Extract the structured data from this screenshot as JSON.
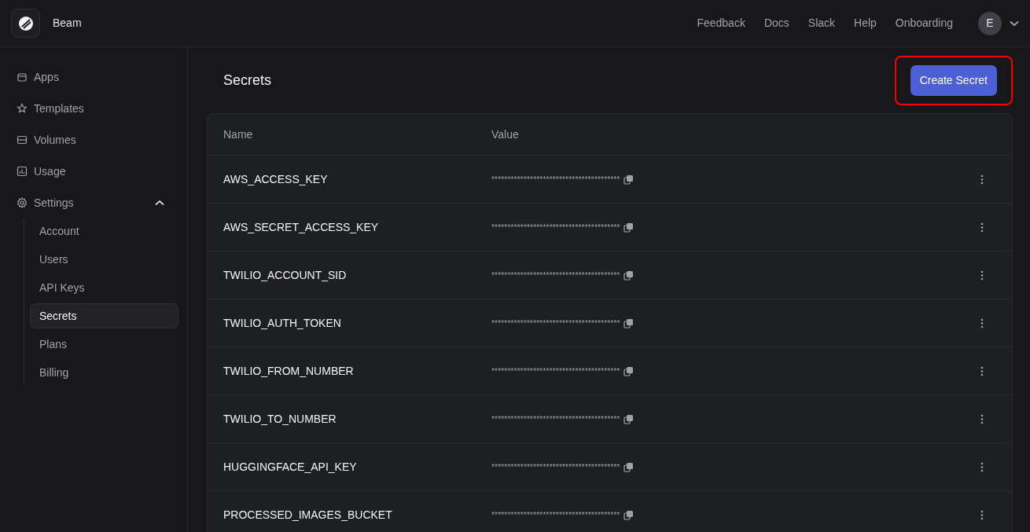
{
  "brand": {
    "name": "Beam"
  },
  "topnav": {
    "links": [
      "Feedback",
      "Docs",
      "Slack",
      "Help",
      "Onboarding"
    ],
    "avatar": "E"
  },
  "sidebar": {
    "items": [
      {
        "label": "Apps",
        "selected": false
      },
      {
        "label": "Templates",
        "selected": false
      },
      {
        "label": "Volumes",
        "selected": false
      },
      {
        "label": "Usage",
        "selected": false
      },
      {
        "label": "Settings",
        "expanded": true,
        "selected": false,
        "children": [
          {
            "label": "Account",
            "selected": false
          },
          {
            "label": "Users",
            "selected": false
          },
          {
            "label": "API Keys",
            "selected": false
          },
          {
            "label": "Secrets",
            "selected": true
          },
          {
            "label": "Plans",
            "selected": false
          },
          {
            "label": "Billing",
            "selected": false
          }
        ]
      }
    ]
  },
  "page": {
    "title": "Secrets",
    "create_button": {
      "label": "Create Secret",
      "highlighted": true
    }
  },
  "table": {
    "columns": [
      "Name",
      "Value"
    ],
    "rows": [
      {
        "name": "AWS_ACCESS_KEY",
        "value": "****************************************"
      },
      {
        "name": "AWS_SECRET_ACCESS_KEY",
        "value": "****************************************"
      },
      {
        "name": "TWILIO_ACCOUNT_SID",
        "value": "****************************************"
      },
      {
        "name": "TWILIO_AUTH_TOKEN",
        "value": "****************************************"
      },
      {
        "name": "TWILIO_FROM_NUMBER",
        "value": "****************************************"
      },
      {
        "name": "TWILIO_TO_NUMBER",
        "value": "****************************************"
      },
      {
        "name": "HUGGINGFACE_API_KEY",
        "value": "****************************************"
      },
      {
        "name": "PROCESSED_IMAGES_BUCKET",
        "value": "****************************************"
      }
    ]
  }
}
